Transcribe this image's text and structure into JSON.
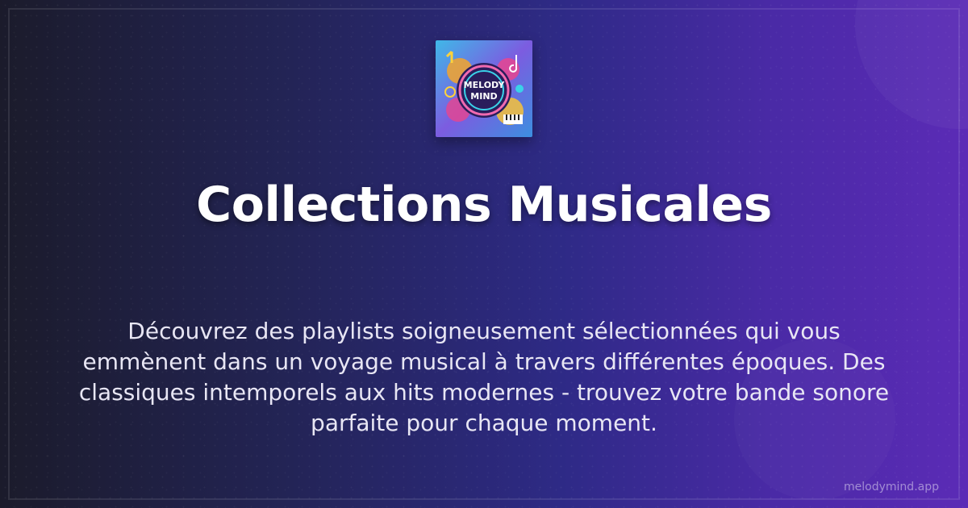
{
  "brand": {
    "logo_text": "MELODY MIND",
    "logo_icon": "melody-mind-logo"
  },
  "main": {
    "title": "Collections Musicales",
    "description": "Découvrez des playlists soigneusement sélectionnées qui vous emmènent dans un voyage musical à travers différentes époques. Des classiques intemporels aux hits modernes - trouvez votre bande sonore parfaite pour chaque moment."
  },
  "footer": {
    "site": "melodymind.app"
  },
  "colors": {
    "background_start": "#1b1b2b",
    "background_end": "#5b2bb6",
    "title": "#ffffff",
    "text": "#e8e6f4"
  }
}
